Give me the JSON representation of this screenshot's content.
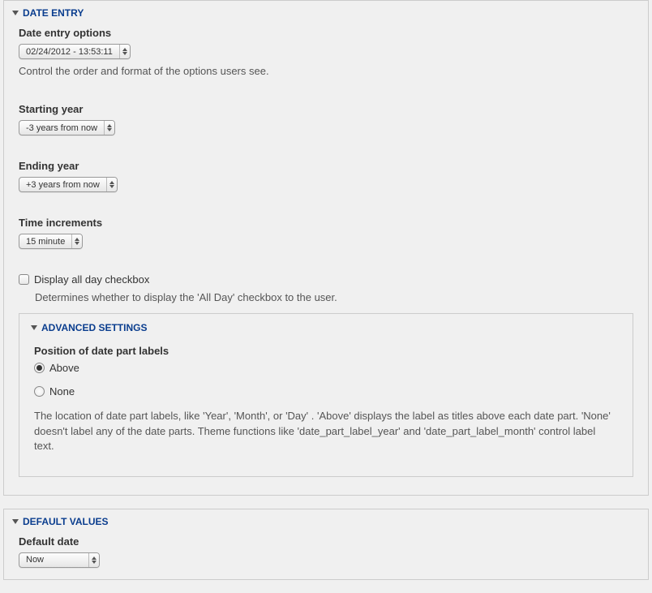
{
  "dateEntry": {
    "legend": "DATE ENTRY",
    "dateEntryOptions": {
      "label": "Date entry options",
      "selected": "02/24/2012 - 13:53:11",
      "description": "Control the order and format of the options users see."
    },
    "startingYear": {
      "label": "Starting year",
      "selected": "-3 years from now"
    },
    "endingYear": {
      "label": "Ending year",
      "selected": "+3 years from now"
    },
    "timeIncrements": {
      "label": "Time increments",
      "selected": "15 minute"
    },
    "displayAllDay": {
      "label": "Display all day checkbox",
      "description": "Determines whether to display the 'All Day' checkbox to the user."
    },
    "advanced": {
      "legend": "ADVANCED SETTINGS",
      "positionLabels": {
        "label": "Position of date part labels",
        "options": {
          "above": "Above",
          "none": "None"
        },
        "description": "The location of date part labels, like 'Year', 'Month', or 'Day' . 'Above' displays the label as titles above each date part. 'None' doesn't label any of the date parts. Theme functions like 'date_part_label_year' and 'date_part_label_month' control label text."
      }
    }
  },
  "defaultValues": {
    "legend": "DEFAULT VALUES",
    "defaultDate": {
      "label": "Default date",
      "selected": "Now"
    }
  }
}
